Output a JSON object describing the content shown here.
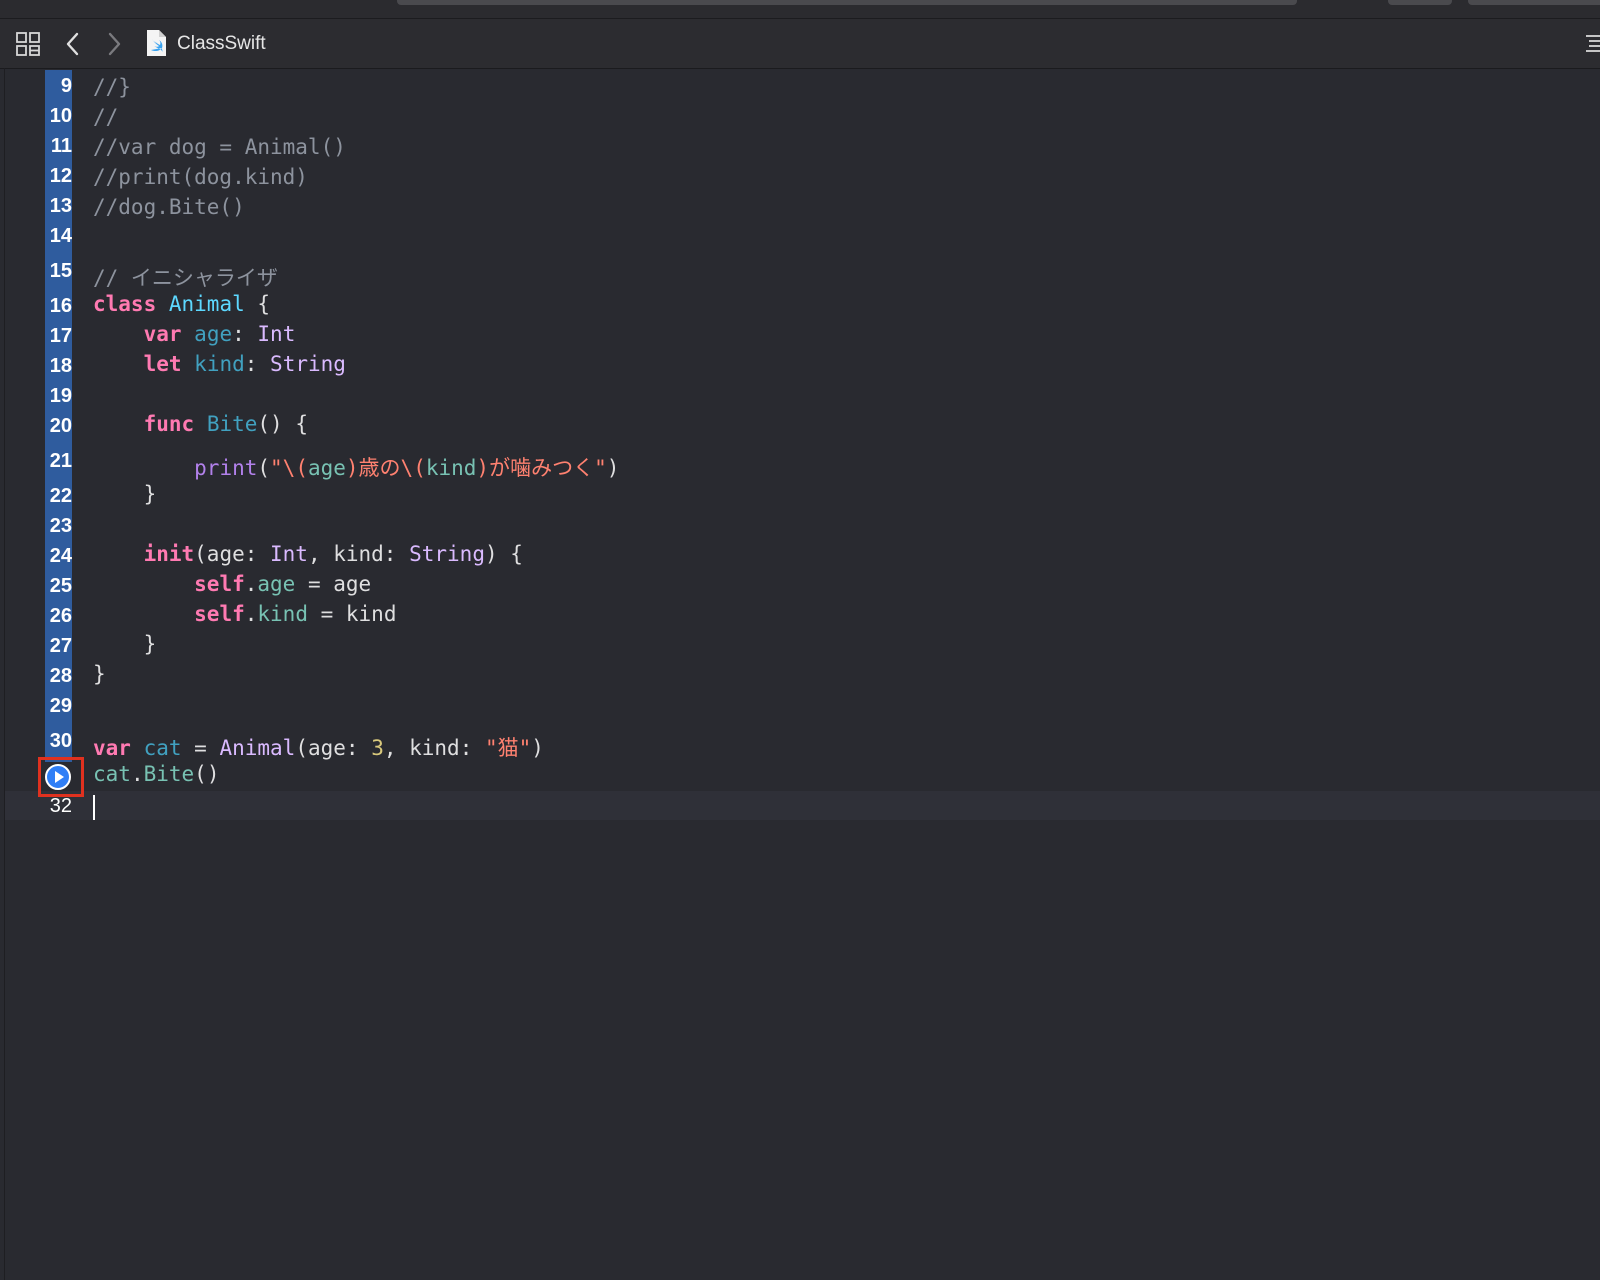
{
  "editor": {
    "filename": "ClassSwift"
  },
  "gutter": {
    "line_numbers": [
      "9",
      "10",
      "11",
      "12",
      "13",
      "14",
      "15",
      "16",
      "17",
      "18",
      "19",
      "20",
      "21",
      "22",
      "23",
      "24",
      "25",
      "26",
      "27",
      "28",
      "29",
      "30",
      "32"
    ]
  },
  "code": {
    "l9": "//}",
    "l10": "//",
    "l11": "//var dog = Animal()",
    "l12": "//print(dog.kind)",
    "l13": "//dog.Bite()",
    "l15": "// イニシャライザ",
    "l16": {
      "kw": "class",
      "name": "Animal",
      "rest": " {"
    },
    "l17": {
      "kw": "var",
      "name": "age",
      "colon": ": ",
      "type": "Int"
    },
    "l18": {
      "kw": "let",
      "name": "kind",
      "colon": ": ",
      "type": "String"
    },
    "l20": {
      "kw": "func",
      "name": "Bite",
      "rest": "() {"
    },
    "l21": {
      "call": "print",
      "p1": "(",
      "q1": "\"\\(",
      "i1": "age",
      "s1": ")歳の\\(",
      "i2": "kind",
      "s2": ")が噛みつく\"",
      "p2": ")"
    },
    "l22": "}",
    "l24": {
      "kw": "init",
      "p1": "(age: ",
      "t1": "Int",
      "p2": ", kind: ",
      "t2": "String",
      "p3": ") {"
    },
    "l25": {
      "kw": "self",
      "dot": ".",
      "prop": "age",
      "rest": " = age"
    },
    "l26": {
      "kw": "self",
      "dot": ".",
      "prop": "kind",
      "rest": " = kind"
    },
    "l27": "}",
    "l28": "}",
    "l30": {
      "kw": "var",
      "name": "cat",
      "eq": " = ",
      "type": "Animal",
      "p1": "(age: ",
      "num": "3",
      "p2": ", kind: ",
      "str": "\"猫\"",
      "p3": ")"
    },
    "l31": {
      "obj": "cat",
      "dot": ".",
      "fn": "Bite",
      "rest": "()"
    }
  },
  "colors": {
    "background": "#292a30",
    "run_bar": "#2f5c9e",
    "highlight_box": "#e0311f",
    "keyword": "#ff7ab2",
    "string": "#ff8170",
    "comment": "#8d939e"
  },
  "icons": [
    "grid-icon",
    "back-arrow-icon",
    "forward-arrow-icon",
    "swift-file-icon",
    "menu-icon",
    "run-play-icon"
  ]
}
